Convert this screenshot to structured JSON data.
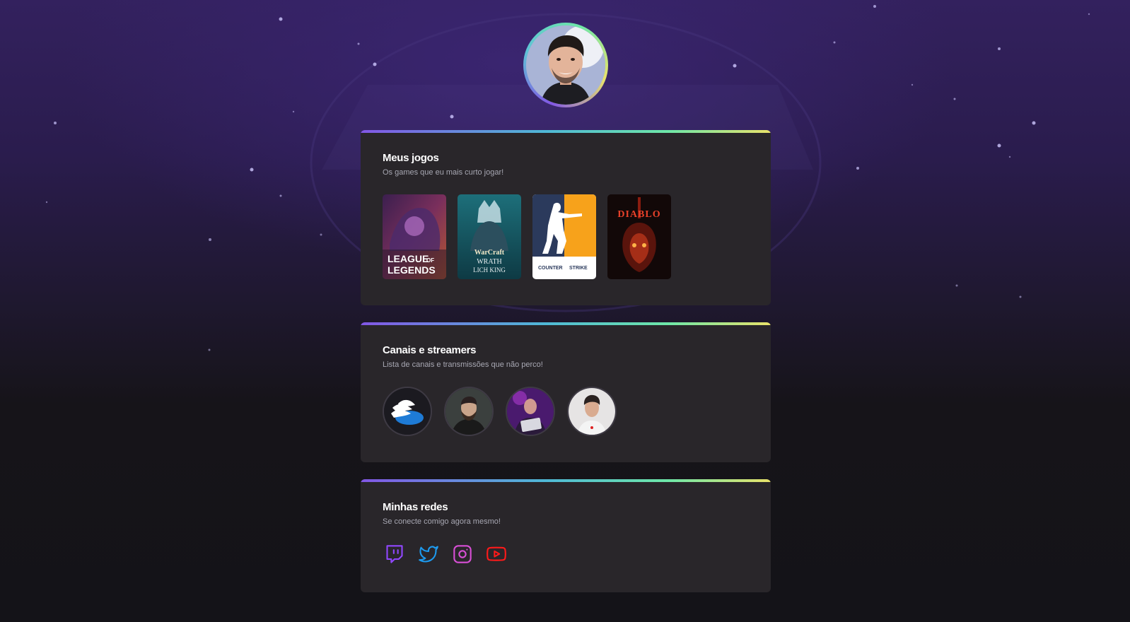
{
  "profile": {
    "avatar_icon": "profile-photo"
  },
  "games_section": {
    "title": "Meus jogos",
    "subtitle": "Os games que eu mais curto jogar!",
    "games": [
      {
        "line1": "LEAGUE",
        "line1b": "OF",
        "line2": "LEGENDS"
      },
      {
        "line1": "WarCraft",
        "line2": "WRATH",
        "line3": "LICH KING"
      },
      {
        "line1": "COUNTER",
        "line2": "STRIKE"
      },
      {
        "line1": "DIABLO"
      }
    ]
  },
  "streamers_section": {
    "title": "Canais e streamers",
    "subtitle": "Lista de canais e transmissões que não perco!"
  },
  "social_section": {
    "title": "Minhas redes",
    "subtitle": "Se conecte comigo agora mesmo!",
    "links": [
      {
        "icon": "twitch-icon",
        "color": "#9147ff"
      },
      {
        "icon": "twitter-icon",
        "color": "#1d9bf0"
      },
      {
        "icon": "instagram-icon",
        "color": "#e1306c"
      },
      {
        "icon": "youtube-icon",
        "color": "#ff0000"
      }
    ]
  },
  "colors": {
    "card": "#29262a",
    "accent_purple": "#8257e5",
    "accent_green": "#6ee7a8",
    "accent_yellow": "#e9e36a"
  }
}
